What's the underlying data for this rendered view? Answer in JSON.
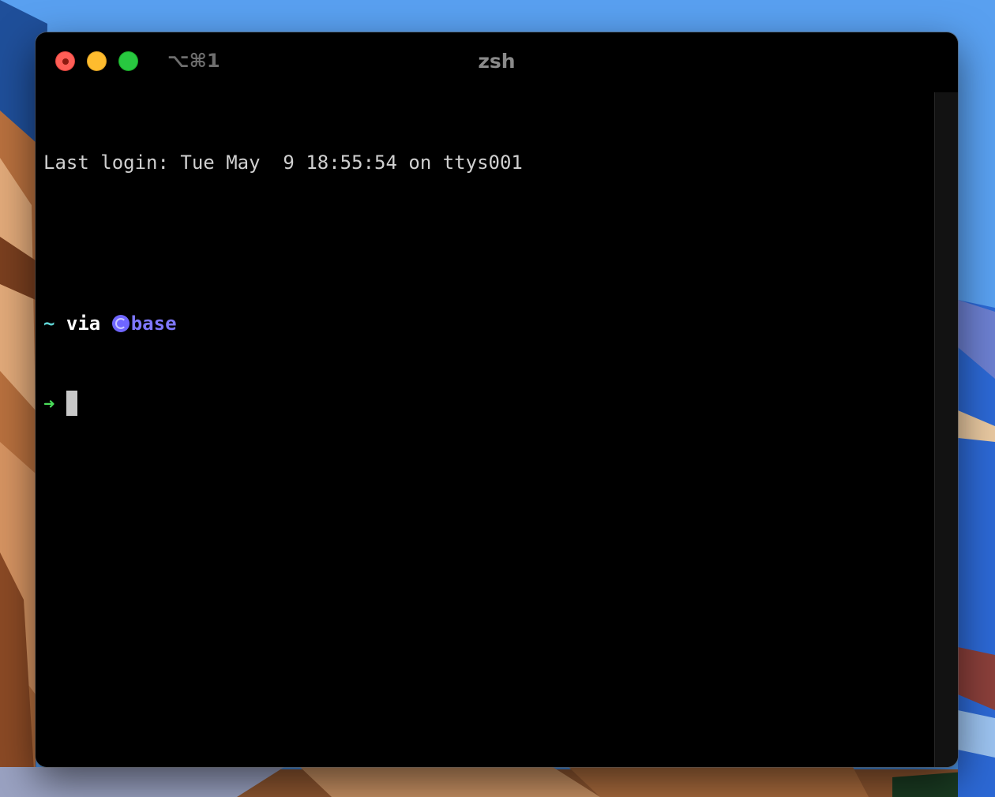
{
  "window": {
    "title": "zsh",
    "shortcut": "⌥⌘1"
  },
  "terminal": {
    "last_login": "Last login: Tue May  9 18:55:54 on ttys001",
    "prompt": {
      "dir": "~",
      "via": "via",
      "env": "base",
      "arrow": "➜"
    }
  },
  "colors": {
    "background": "#000000",
    "text": "#d0d0d0",
    "prompt_dir": "#5fd3d3",
    "prompt_env": "#7f78ff",
    "prompt_arrow": "#4ade5a",
    "close": "#ff5f57",
    "minimize": "#febc2e",
    "zoom": "#28c840"
  },
  "icons": {
    "env": "conda-icon"
  }
}
